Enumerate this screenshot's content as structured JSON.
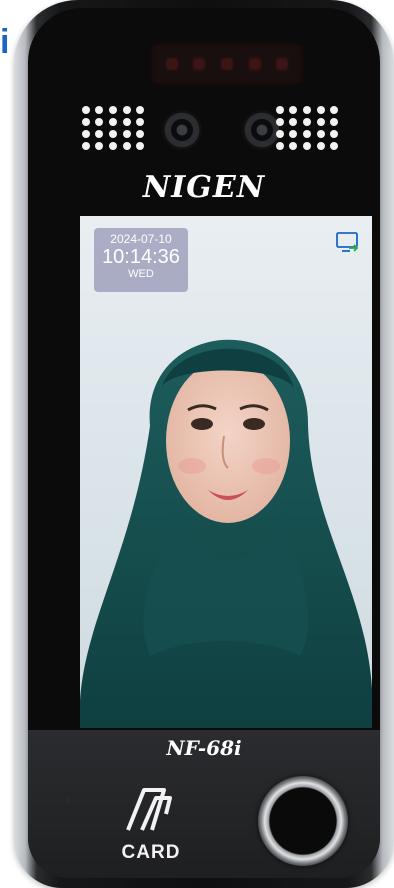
{
  "corner_text": "i",
  "device": {
    "brand": "NIGEN",
    "model": "NF-68i"
  },
  "screen": {
    "date": "2024-07-10",
    "time": "10:14:36",
    "weekday": "WED",
    "status_icon": "monitor-arrow-icon"
  },
  "controls": {
    "card_label": "CARD",
    "card_icon": "card-reader-icon",
    "fingerprint_icon": "fingerprint-sensor-icon"
  },
  "colors": {
    "accent_link": "#1f63c7",
    "icon_blue": "#1a67c7",
    "icon_green": "#2aa84a"
  }
}
